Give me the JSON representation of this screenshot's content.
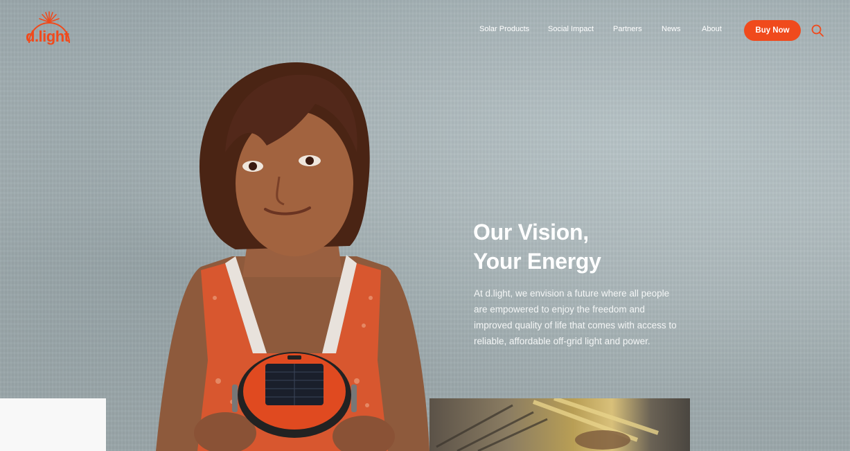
{
  "brand": {
    "logo_text": "d.light",
    "accent_color": "#f04a1c"
  },
  "nav": {
    "items": [
      {
        "label": "Solar Products"
      },
      {
        "label": "Social Impact"
      },
      {
        "label": "Partners"
      },
      {
        "label": "News"
      },
      {
        "label": "About"
      }
    ],
    "buy_label": "Buy Now",
    "search_icon": "search-icon"
  },
  "hero": {
    "title_line1": "Our Vision,",
    "title_line2": "Your Energy",
    "body": "At d.light, we envision a future where all people are empowered to enjoy the freedom and improved quality of life that comes with access to reliable, affordable off-grid light and power."
  }
}
